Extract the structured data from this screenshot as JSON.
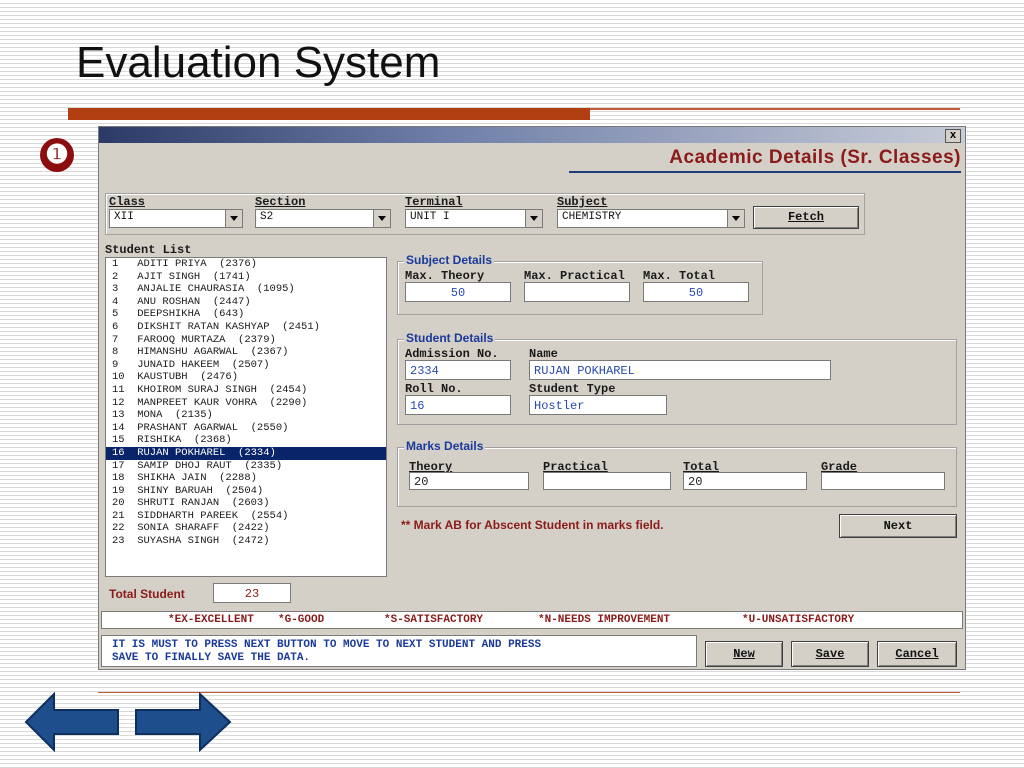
{
  "slide": {
    "title": "Evaluation System",
    "bullet": "❶"
  },
  "window": {
    "close_glyph": "x",
    "form_title": "Academic Details (Sr. Classes)"
  },
  "filters": {
    "class_label": "Class",
    "class_value": "XII",
    "section_label": "Section",
    "section_value": "S2",
    "terminal_label": "Terminal",
    "terminal_value": "UNIT I",
    "subject_label": "Subject",
    "subject_value": "CHEMISTRY",
    "fetch_label": "Fetch"
  },
  "student_list": {
    "label": "Student List",
    "items": [
      "1   ADITI PRIYA  (2376)",
      "2   AJIT SINGH  (1741)",
      "3   ANJALIE CHAURASIA  (1095)",
      "4   ANU ROSHAN  (2447)",
      "5   DEEPSHIKHA  (643)",
      "6   DIKSHIT RATAN KASHYAP  (2451)",
      "7   FAROOQ MURTAZA  (2379)",
      "8   HIMANSHU AGARWAL  (2367)",
      "9   JUNAID HAKEEM  (2507)",
      "10  KAUSTUBH  (2476)",
      "11  KHOIROM SURAJ SINGH  (2454)",
      "12  MANPREET KAUR VOHRA  (2290)",
      "13  MONA  (2135)",
      "14  PRASHANT AGARWAL  (2550)",
      "15  RISHIKA  (2368)",
      "16  RUJAN POKHAREL  (2334)",
      "17  SAMIP DHOJ RAUT  (2335)",
      "18  SHIKHA JAIN  (2288)",
      "19  SHINY BARUAH  (2504)",
      "20  SHRUTI RANJAN  (2603)",
      "21  SIDDHARTH PAREEK  (2554)",
      "22  SONIA SHARAFF  (2422)",
      "23  SUYASHA SINGH  (2472)"
    ],
    "selected_index": 15
  },
  "subject_details": {
    "legend": "Subject Details",
    "max_theory_label": "Max. Theory",
    "max_theory_value": "50",
    "max_practical_label": "Max. Practical",
    "max_practical_value": "",
    "max_total_label": "Max. Total",
    "max_total_value": "50"
  },
  "student_details": {
    "legend": "Student Details",
    "admission_label": "Admission No.",
    "admission_value": "2334",
    "name_label": "Name",
    "name_value": "RUJAN POKHAREL",
    "roll_label": "Roll No.",
    "roll_value": "16",
    "type_label": "Student Type",
    "type_value": "Hostler"
  },
  "marks_details": {
    "legend": "Marks Details",
    "theory_label": "Theory",
    "theory_value": "20",
    "practical_label": "Practical",
    "practical_value": "",
    "total_label": "Total",
    "total_value": "20",
    "grade_label": "Grade",
    "grade_value": ""
  },
  "hint": "** Mark AB for Abscent Student in marks field.",
  "next_label": "Next",
  "total_student_label": "Total Student",
  "total_student_value": "23",
  "grade_legend": [
    "*EX-EXCELLENT",
    "*G-GOOD",
    "*S-SATISFACTORY",
    "*N-NEEDS IMPROVEMENT",
    "*U-UNSATISFACTORY"
  ],
  "note": {
    "line1": "IT IS MUST TO PRESS NEXT BUTTON TO MOVE TO NEXT STUDENT AND PRESS",
    "line2": "SAVE TO FINALLY SAVE THE DATA."
  },
  "buttons": {
    "new_label": "New",
    "save_label": "Save",
    "cancel_label": "Cancel"
  },
  "colors": {
    "accent_bar": "#b13f12",
    "title_red": "#8b1a1a",
    "label_blue": "#1a3a9a",
    "arrow_blue": "#1f4e8c"
  },
  "icons": {
    "back": "arrow-left-icon",
    "forward": "arrow-right-icon"
  }
}
